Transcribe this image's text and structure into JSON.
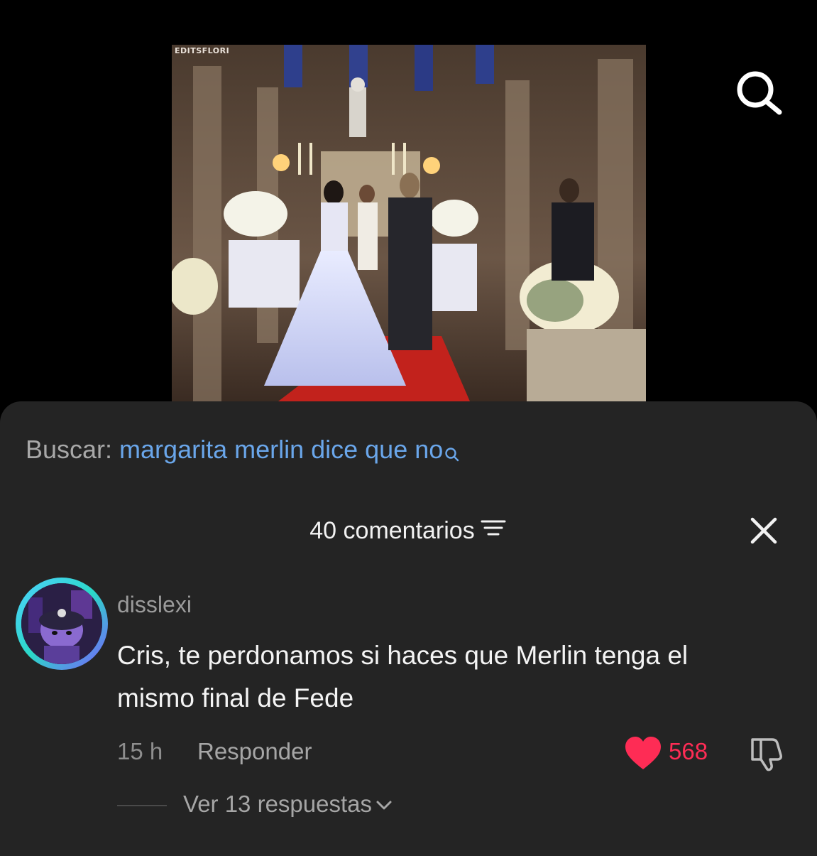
{
  "video": {
    "watermark": "EDITSFLORI"
  },
  "header": {
    "search_icon": "search-icon"
  },
  "search_suggestion": {
    "label": "Buscar: ",
    "query": "margarita merlin dice que no",
    "icon": "search-icon"
  },
  "comments": {
    "count_label": "40 comentarios",
    "sort_icon": "sort-icon",
    "close_icon": "close-icon",
    "items": [
      {
        "username": "disslexi",
        "text": "Cris, te perdonamos si haces que Merlin tenga el mismo final de Fede",
        "time": "15 h",
        "reply_label": "Responder",
        "likes": "568",
        "liked": true,
        "view_replies_label": "Ver 13 respuestas"
      }
    ]
  },
  "colors": {
    "background": "#000000",
    "sheet": "#242424",
    "link_blue": "#6aa6ea",
    "like_red": "#fe2c55",
    "muted_text": "#a6a6a6"
  }
}
